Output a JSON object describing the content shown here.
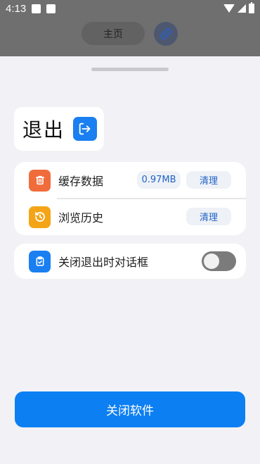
{
  "status_bar": {
    "time": "4:13"
  },
  "top_bar": {
    "home_label": "主页"
  },
  "title": "退出",
  "cache_card": {
    "cache_label": "缓存数据",
    "cache_size": "0.97MB",
    "clean_label": "清理",
    "history_label": "浏览历史",
    "history_clean_label": "清理"
  },
  "dialog_card": {
    "label": "关闭退出时对话框",
    "toggle_on": false
  },
  "close_button_label": "关闭软件",
  "colors": {
    "accent": "#0c7ff2",
    "cache_icon": "#f06c3b",
    "history_icon": "#f3a517",
    "dialog_icon": "#1a7ff0"
  },
  "icons": {
    "status_left": [
      "square-notification-icon",
      "square-notification-icon"
    ],
    "status_right": [
      "wifi-icon",
      "signal-icon",
      "battery-icon"
    ],
    "top_right": "link-icon",
    "title": "exit-icon",
    "cache": "trash-icon",
    "history": "history-clock-icon",
    "dialog": "clipboard-check-icon"
  }
}
